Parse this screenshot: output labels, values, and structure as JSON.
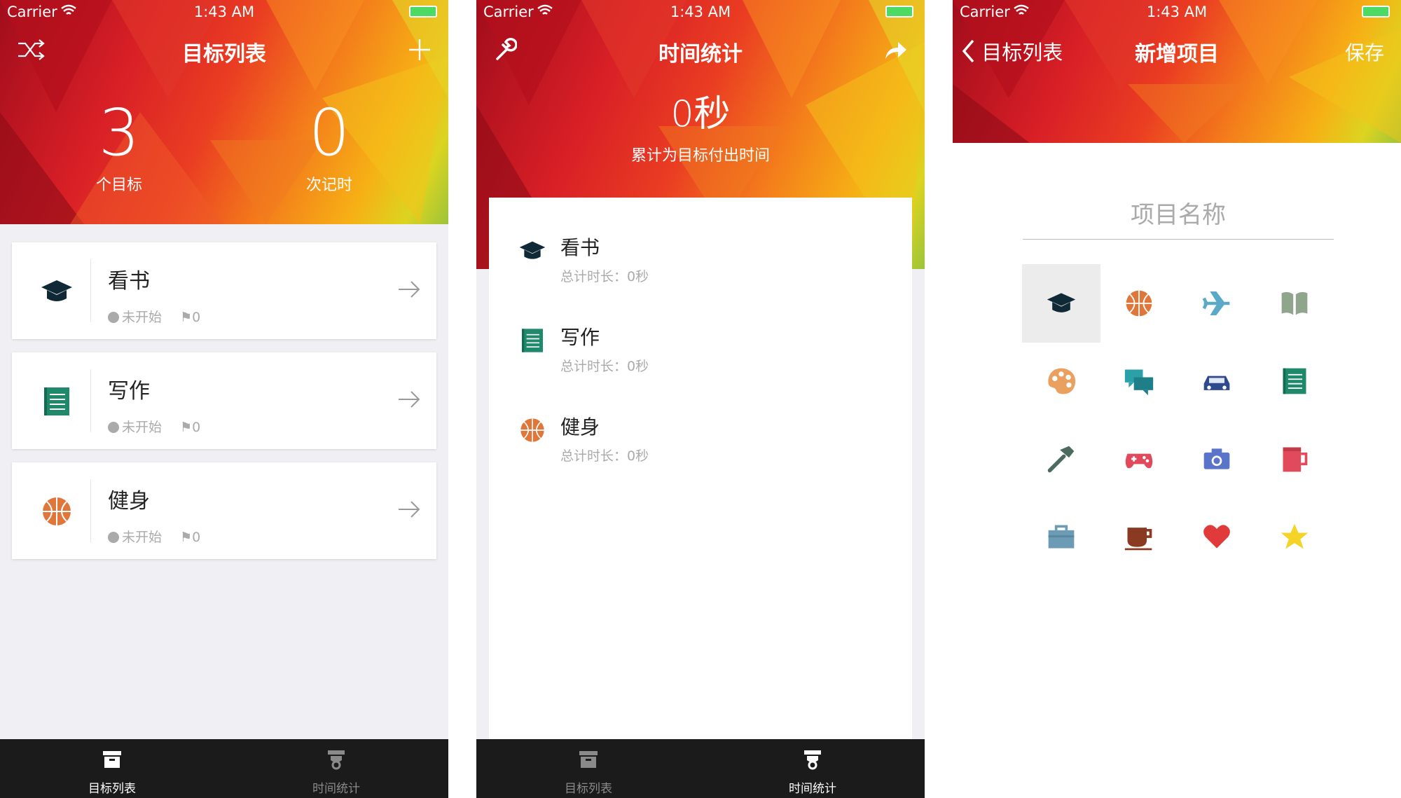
{
  "status": {
    "carrier": "Carrier",
    "time": "1:43 AM"
  },
  "screen1": {
    "title": "目标列表",
    "stats": [
      {
        "value": "3",
        "label": "个目标"
      },
      {
        "value": "0",
        "label": "次记时"
      }
    ],
    "goals": [
      {
        "title": "看书",
        "status": "未开始",
        "count": "0",
        "icon": "graduation-cap-icon"
      },
      {
        "title": "写作",
        "status": "未开始",
        "count": "0",
        "icon": "notebook-icon"
      },
      {
        "title": "健身",
        "status": "未开始",
        "count": "0",
        "icon": "basketball-icon"
      }
    ]
  },
  "screen2": {
    "title": "时间统计",
    "total": "0秒",
    "total_label": "累计为目标付出时间",
    "items": [
      {
        "title": "看书",
        "detail": "总计时长：0秒",
        "icon": "graduation-cap-icon"
      },
      {
        "title": "写作",
        "detail": "总计时长：0秒",
        "icon": "notebook-icon"
      },
      {
        "title": "健身",
        "detail": "总计时长：0秒",
        "icon": "basketball-icon"
      }
    ]
  },
  "screen3": {
    "back_label": "目标列表",
    "title": "新增项目",
    "save_label": "保存",
    "name_placeholder": "项目名称",
    "icons": [
      "graduation-cap-icon",
      "basketball-icon",
      "airplane-icon",
      "book-icon",
      "palette-icon",
      "chat-icon",
      "car-icon",
      "notebook-icon",
      "hammer-icon",
      "gamepad-icon",
      "camera-icon",
      "mug-icon",
      "briefcase-icon",
      "coffee-icon",
      "heart-icon",
      "star-icon"
    ]
  },
  "tabs": [
    {
      "label": "目标列表",
      "icon": "archive-box-icon"
    },
    {
      "label": "时间统计",
      "icon": "trophy-icon"
    }
  ],
  "colors": {
    "tab_bar": "#1b1b1b",
    "tab_active": "#ffffff",
    "tab_inactive": "#8a8a8a",
    "cap": "#0f2a36",
    "notebook": "#1f8a6b",
    "basketball": "#e0763a"
  }
}
